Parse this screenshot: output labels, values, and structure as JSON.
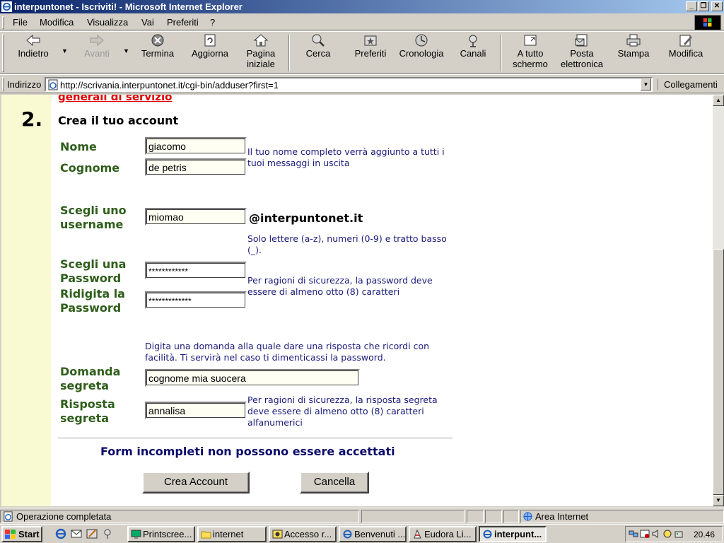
{
  "window": {
    "title": "interpuntonet - Iscriviti! - Microsoft Internet Explorer",
    "controls": [
      "minimize",
      "maximize",
      "close"
    ]
  },
  "menu": [
    "File",
    "Modifica",
    "Visualizza",
    "Vai",
    "Preferiti",
    "?"
  ],
  "toolbar": {
    "back": "Indietro",
    "forward": "Avanti",
    "stop": "Termina",
    "refresh": "Aggiorna",
    "home_l1": "Pagina",
    "home_l2": "iniziale",
    "search": "Cerca",
    "favorites": "Preferiti",
    "history": "Cronologia",
    "channels": "Canali",
    "fullscreen_l1": "A tutto",
    "fullscreen_l2": "schermo",
    "mail_l1": "Posta",
    "mail_l2": "elettronica",
    "print": "Stampa",
    "edit": "Modifica"
  },
  "address": {
    "label": "Indirizzo",
    "url": "http://scrivania.interpuntonet.it/cgi-bin/adduser?first=1",
    "links": "Collegamenti"
  },
  "page": {
    "cut_link": "generali di servizio",
    "step_number": "2.",
    "section_title": "Crea il tuo account",
    "nome_label": "Nome",
    "nome_value": "giacomo",
    "cognome_label": "Cognome",
    "cognome_value": "de petris",
    "name_help": "Il tuo nome completo verrà aggiunto a tutti i tuoi messaggi in uscita",
    "username_label_l1": "Scegli uno",
    "username_label_l2": "username",
    "username_value": "miomao",
    "domain": "@interpuntonet.it",
    "username_help": "Solo lettere (a-z), numeri (0-9) e tratto basso (_).",
    "password_label_l1": "Scegli una",
    "password_label_l2": "Password",
    "password_value": "************",
    "password2_label_l1": "Ridigita la",
    "password2_label_l2": "Password",
    "password2_value": "*************",
    "password_help": "Per ragioni di sicurezza, la password deve essere di almeno otto (8) caratteri",
    "question_intro": "Digita una domanda alla quale dare una risposta che ricordi con facilità. Ti servirà nel caso ti dimenticassi la password.",
    "question_label_l1": "Domanda",
    "question_label_l2": "segreta",
    "question_value": "cognome mia suocera",
    "answer_label_l1": "Risposta",
    "answer_label_l2": "segreta",
    "answer_value": "annalisa",
    "answer_help": "Per ragioni di sicurezza, la risposta segreta deve essere di almeno otto (8) caratteri alfanumerici",
    "warning": "Form incompleti non possono essere accettati",
    "create_button": "Crea Account",
    "cancel_button": "Cancella"
  },
  "status": {
    "text": "Operazione completata",
    "zone": "Area Internet"
  },
  "taskbar": {
    "start": "Start",
    "tasks": [
      "Printscree...",
      "internet",
      "Accesso r...",
      "Benvenuti ...",
      "Eudora Li...",
      "interpunt..."
    ],
    "active_task": "interpunt...",
    "clock": "20.46"
  },
  "colors": {
    "title_start": "#0a246a",
    "title_end": "#a6caf0",
    "chrome": "#d4d0c8",
    "label_green": "#2e5e1a",
    "help_navy": "#1a1a7a",
    "link_red": "#e00000",
    "left_band": "#fafad2"
  }
}
